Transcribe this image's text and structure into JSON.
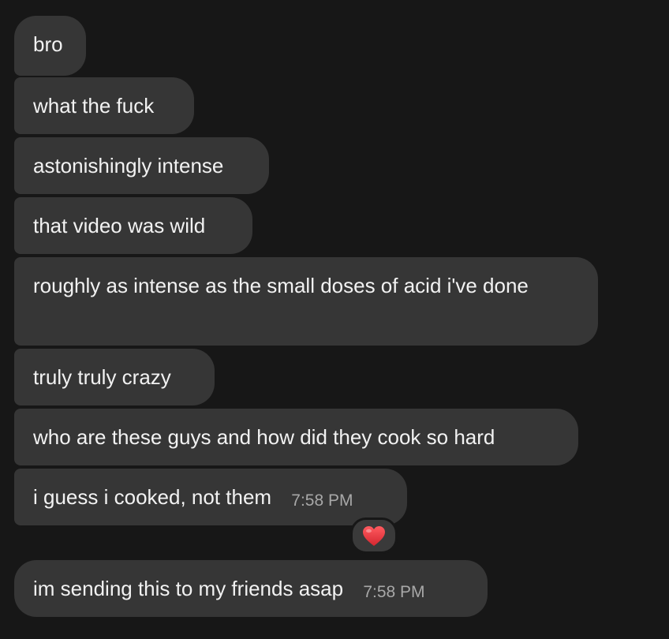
{
  "messages": [
    {
      "text": "bro"
    },
    {
      "text": "what the fuck"
    },
    {
      "text": "astonishingly intense"
    },
    {
      "text": "that video was wild"
    },
    {
      "text": "roughly as intense as the small doses of acid i've done"
    },
    {
      "text": "truly truly crazy"
    },
    {
      "text": "who are these guys and how did they cook so hard"
    },
    {
      "text": "i guess i cooked, not them",
      "time": "7:58 PM",
      "reaction": "red-heart-icon"
    },
    {
      "text": "im sending this to my friends asap",
      "time": "7:58 PM"
    }
  ],
  "colors": {
    "background": "#171717",
    "bubble": "#363636",
    "timestamp": "#a8a8a8",
    "heart": "#e0303a"
  }
}
